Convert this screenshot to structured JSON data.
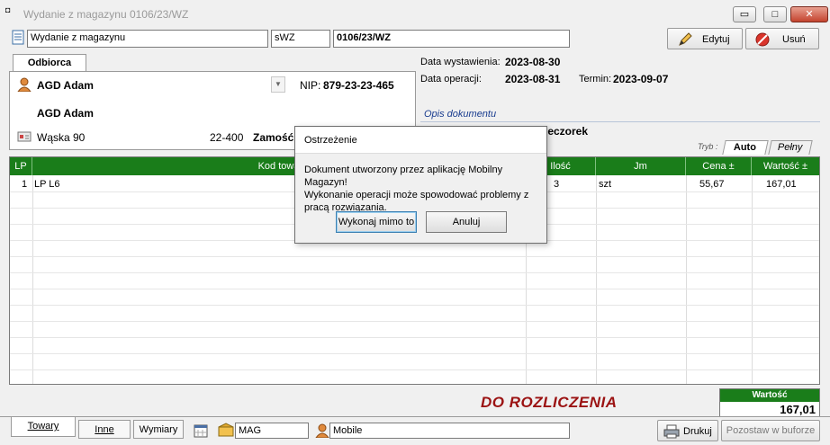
{
  "window": {
    "title": "Wydanie z magazynu 0106/23/WZ",
    "minimize_label": "▭",
    "maximize_label": "□",
    "close_label": "✕"
  },
  "doc_header": {
    "doc_type": "Wydanie z magazynu",
    "doc_code": "sWZ",
    "doc_number": "0106/23/WZ",
    "edit_label": "Edytuj",
    "delete_label": "Usuń"
  },
  "recipient": {
    "tab_label": "Odbiorca",
    "name_combo": "AGD Adam",
    "nip_label": "NIP:",
    "nip_value": "879-23-23-465",
    "full_name": "AGD Adam",
    "street": "Wąska 90",
    "postal_code": "22-400",
    "city": "Zamość"
  },
  "dates": {
    "issue_label": "Data wystawienia:",
    "issue_value": "2023-08-30",
    "operation_label": "Data operacji:",
    "operation_value": "2023-08-31",
    "due_label": "Termin:",
    "due_value": "2023-09-07",
    "description_label": "Opis dokumentu",
    "issuer_partial": "ieczorek"
  },
  "mode": {
    "label": "Tryb :",
    "auto": "Auto",
    "full": "Pełny"
  },
  "grid": {
    "columns": [
      "LP",
      "Kod towa",
      "Ilość",
      "Jm",
      "Cena ±",
      "Wartość ±"
    ],
    "rows": [
      {
        "lp": "1",
        "kod": "LP L6",
        "ilosc": "3",
        "jm": "szt",
        "cena": "55,67",
        "wartosc": "167,01"
      }
    ]
  },
  "dialog": {
    "title": "Ostrzeżenie",
    "message_line1": "Dokument utworzony przez aplikację Mobilny Magazyn!",
    "message_line2": "Wykonanie operacji może spowodować problemy z",
    "message_line3": "pracą rozwiązania.",
    "ok_label": "Wykonaj mimo to",
    "cancel_label": "Anuluj"
  },
  "footer": {
    "status_text": "DO ROZLICZENIA",
    "total_label": "Wartość",
    "total_value": "167,01",
    "tab_towary": "Towary",
    "tab_inne": "Inne",
    "tab_wymiary": "Wymiary",
    "warehouse": "MAG",
    "user": "Mobile",
    "print_label": "Drukuj",
    "leave_label": "Pozostaw w buforze"
  }
}
